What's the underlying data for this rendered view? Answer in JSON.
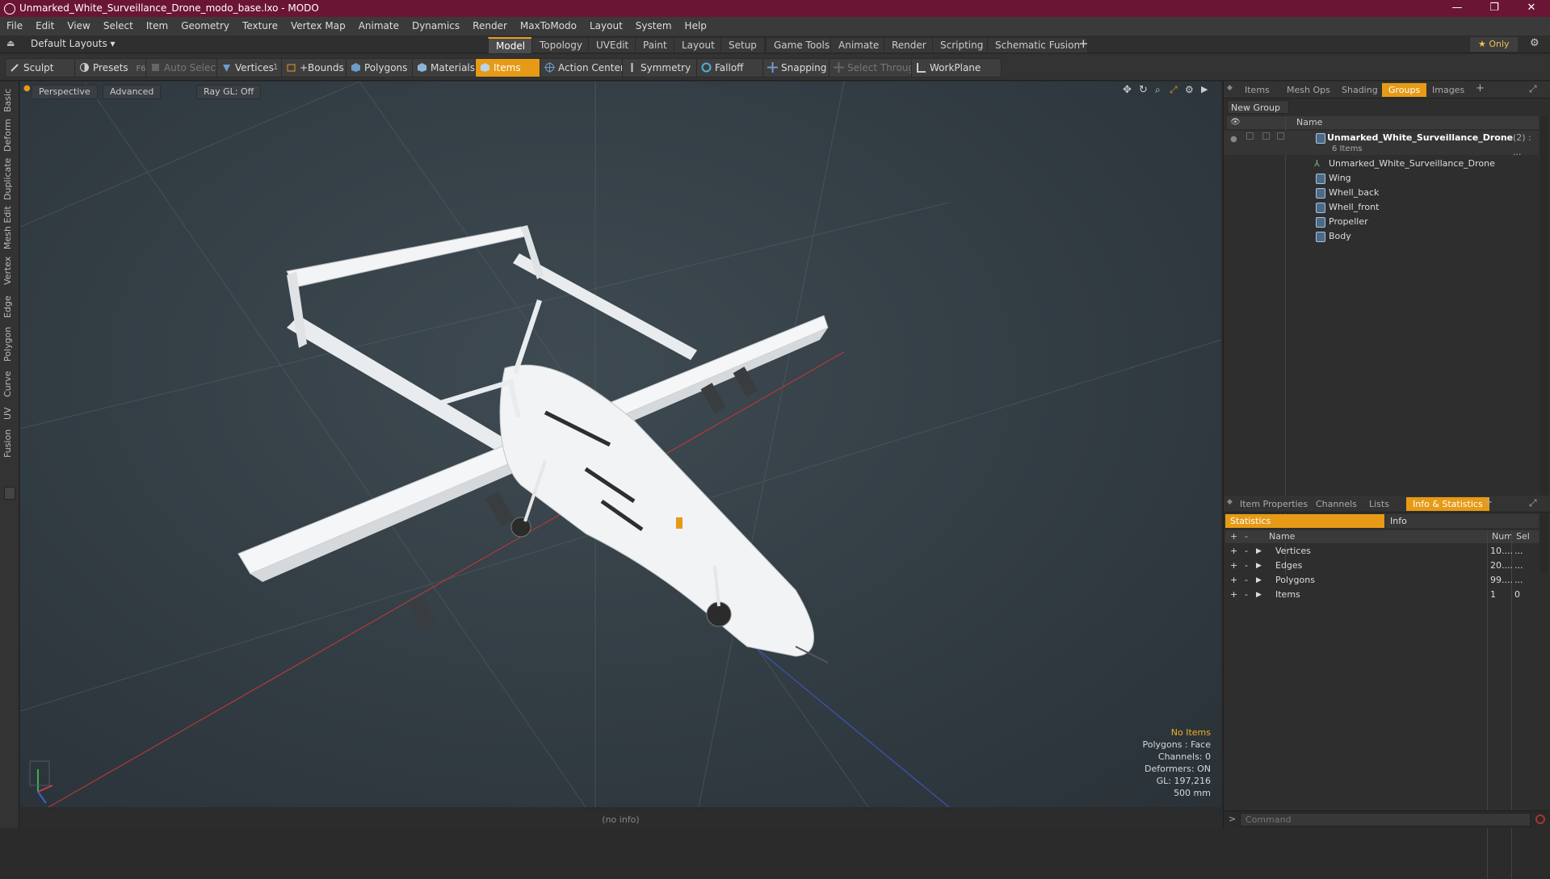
{
  "window": {
    "title": "Unmarked_White_Surveillance_Drone_modo_base.lxo - MODO",
    "minimize": "—",
    "maximize": "❐",
    "close": "✕"
  },
  "menu": [
    "File",
    "Edit",
    "View",
    "Select",
    "Item",
    "Geometry",
    "Texture",
    "Vertex Map",
    "Animate",
    "Dynamics",
    "Render",
    "MaxToModo",
    "Layout",
    "System",
    "Help"
  ],
  "layouts": {
    "selector": "Default Layouts ▾",
    "tabs": [
      "Model",
      "Topology",
      "UVEdit",
      "Paint",
      "Layout",
      "Setup",
      "Game Tools",
      "Animate",
      "Render",
      "Scripting",
      "Schematic Fusion"
    ],
    "active_tab": "Model",
    "add": "+",
    "only": "★  Only",
    "gear": "⚙"
  },
  "toolbar": {
    "sculpt": "Sculpt",
    "presets": "Presets",
    "presets_key": "F6",
    "auto_select": "Auto Select",
    "vertices": "Vertices",
    "vertices_count": "1",
    "bounds": "+Bounds",
    "polygons": "Polygons",
    "materials": "Materials",
    "items": "Items",
    "action_center": "Action Center",
    "symmetry": "Symmetry",
    "falloff": "Falloff",
    "snapping": "Snapping",
    "select_through": "Select Through",
    "workplane": "WorkPlane"
  },
  "left_tabs": [
    "Basic",
    "Deform",
    "Duplicate",
    "Mesh Edit",
    "Vertex",
    "Edge",
    "Polygon",
    "Curve",
    "UV",
    "Fusion"
  ],
  "viewport": {
    "perspective": "Perspective",
    "advanced": "Advanced",
    "raygl": "Ray GL: Off",
    "info": {
      "no_items": "No Items",
      "polygons": "Polygons : Face",
      "channels": "Channels: 0",
      "deformers": "Deformers: ON",
      "gl": "GL: 197,216",
      "scale": "500 mm"
    }
  },
  "status": "(no info)",
  "groups_panel": {
    "tabs": [
      "Items",
      "Mesh Ops",
      "Shading",
      "Groups",
      "Images"
    ],
    "active_tab": "Groups",
    "new_group": "New Group",
    "name_header": "Name",
    "group_name": "Unmarked_White_Surveillance_Drone",
    "group_count": "(2) : ...",
    "group_sub": "6 Items",
    "children": [
      "Unmarked_White_Surveillance_Drone",
      "Wing",
      "Whell_back",
      "Whell_front",
      "Propeller",
      "Body"
    ]
  },
  "stats_panel": {
    "tabs": [
      "Item Properties",
      "Channels",
      "Lists",
      "Info & Statistics"
    ],
    "active_tab": "Info & Statistics",
    "subtabs": [
      "Statistics",
      "Info"
    ],
    "headers": {
      "name": "Name",
      "num": "Num",
      "sel": "Sel"
    },
    "rows": [
      {
        "name": "Vertices",
        "num": "10....",
        "sel": "..."
      },
      {
        "name": "Edges",
        "num": "20....",
        "sel": "..."
      },
      {
        "name": "Polygons",
        "num": "99....",
        "sel": "..."
      },
      {
        "name": "Items",
        "num": "1",
        "sel": "0"
      }
    ]
  },
  "command": {
    "placeholder": "Command"
  },
  "colors": {
    "accent": "#e69a16",
    "titlebar": "#6b1535",
    "mesh": "#4b6a88"
  }
}
